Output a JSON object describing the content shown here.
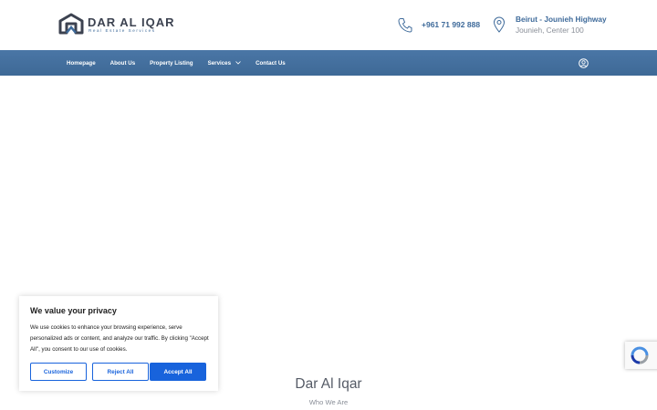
{
  "header": {
    "logo_title": "DAR AL IQAR",
    "logo_subtitle": "Real Estate Services",
    "phone": "+961 71 992 888",
    "address_line1": "Beirut - Jounieh Highway",
    "address_line2": "Jounieh, Center 100"
  },
  "nav": {
    "items": [
      {
        "label": "Homepage"
      },
      {
        "label": "About Us"
      },
      {
        "label": "Property Listing"
      },
      {
        "label": "Services"
      },
      {
        "label": "Contact Us"
      }
    ]
  },
  "cookie": {
    "title": "We value your privacy",
    "text": "We use cookies to enhance your browsing experience, serve personalized ads or content, and analyze our traffic. By clicking \"Accept All\", you consent to our use of cookies.",
    "customize_label": "Customize",
    "reject_label": "Reject All",
    "accept_label": "Accept All"
  },
  "main": {
    "section_title": "Dar Al Iqar",
    "section_subtitle": "Who We Are"
  },
  "colors": {
    "brand_blue": "#3e6a9a",
    "nav_bg": "#4a76a6",
    "cookie_accent": "#1863dc"
  },
  "icons": [
    "logo-house-icon",
    "phone-icon",
    "location-pin-icon",
    "chevron-down-icon",
    "user-circle-icon",
    "recaptcha-icon"
  ]
}
